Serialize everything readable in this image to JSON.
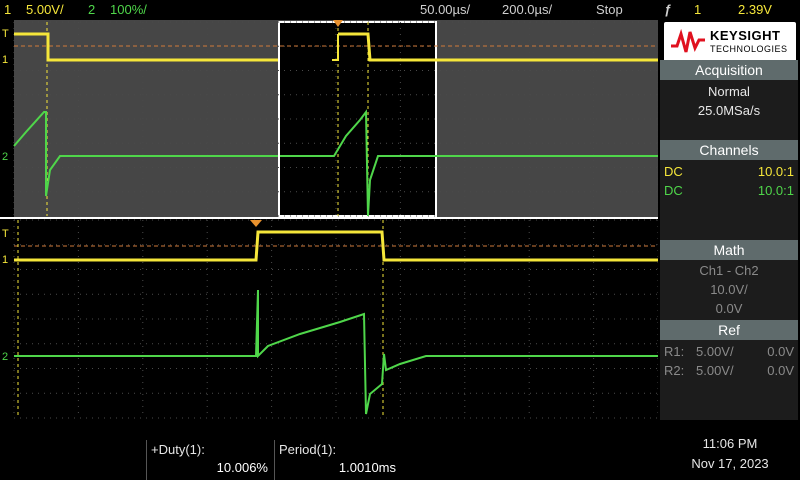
{
  "topbar": {
    "ch1_num": "1",
    "ch1_scale": "5.00V/",
    "ch2_num": "2",
    "ch2_scale": "100%/",
    "time_offset": "50.00µs/",
    "time_scale": "200.0µs/",
    "run_state": "Stop",
    "trigger_icon": "ƒ",
    "trigger_source": "1",
    "trigger_level": "2.39V"
  },
  "brand": {
    "name": "KEYSIGHT",
    "sub": "TECHNOLOGIES"
  },
  "acquisition": {
    "title": "Acquisition",
    "mode": "Normal",
    "rate": "25.0MSa/s"
  },
  "channels": {
    "title": "Channels",
    "rows": [
      {
        "coupling": "DC",
        "probe": "10.0:1"
      },
      {
        "coupling": "DC",
        "probe": "10.0:1"
      }
    ]
  },
  "math": {
    "title": "Math",
    "func": "Ch1 - Ch2",
    "scale": "10.0V/",
    "offset": "0.0V"
  },
  "ref": {
    "title": "Ref",
    "rows": [
      {
        "label": "R1:",
        "scale": "5.00V/",
        "offset": "0.0V"
      },
      {
        "label": "R2:",
        "scale": "5.00V/",
        "offset": "0.0V"
      }
    ]
  },
  "measurements": [
    {
      "name": "+Duty(1):",
      "value": "10.006%"
    },
    {
      "name": "Period(1):",
      "value": "1.0010ms"
    }
  ],
  "clock": {
    "time": "11:06 PM",
    "date": "Nov 17, 2023"
  },
  "marker_labels": {
    "trigger": "T",
    "ch1": "1",
    "ch2": "2"
  },
  "colors": {
    "ch1": "#f5e63a",
    "ch2": "#4fd64a",
    "panel_header": "#5f6b6c",
    "grid_dim": "#4a4a4a"
  }
}
